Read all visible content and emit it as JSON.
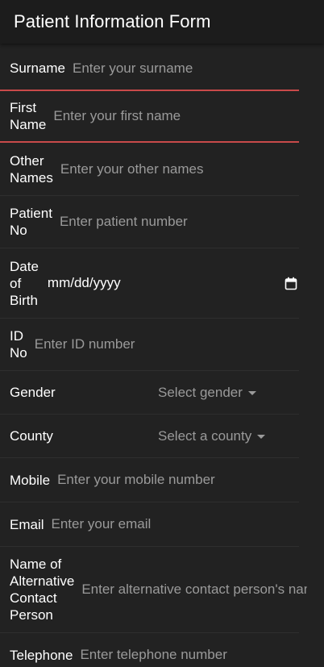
{
  "header": {
    "title": "Patient Information Form"
  },
  "form": {
    "surname": {
      "label": "Surname",
      "placeholder": "Enter your surname"
    },
    "first_name": {
      "label": "First\nName",
      "placeholder": "Enter your first name"
    },
    "other_names": {
      "label": "Other\nNames",
      "placeholder": "Enter your other names"
    },
    "patient_no": {
      "label": "Patient\nNo",
      "placeholder": "Enter patient number"
    },
    "dob": {
      "label": "Date\nof\nBirth",
      "value": "mm/dd/yyyy"
    },
    "id_no": {
      "label": "ID\nNo",
      "placeholder": "Enter ID number"
    },
    "gender": {
      "label": "Gender",
      "selected": "Select gender"
    },
    "county": {
      "label": "County",
      "selected": "Select a county"
    },
    "mobile": {
      "label": "Mobile",
      "placeholder": "Enter your mobile number"
    },
    "email": {
      "label": "Email",
      "placeholder": "Enter your email"
    },
    "alt_contact": {
      "label": "Name of\nAlternative\nContact\nPerson",
      "placeholder": "Enter alternative contact person's name"
    },
    "telephone": {
      "label": "Telephone",
      "placeholder": "Enter telephone number"
    }
  },
  "colors": {
    "background": "#222222",
    "header_bg": "#1c1c1c",
    "error_border": "#c94a4a",
    "placeholder": "#9a9a9a"
  }
}
